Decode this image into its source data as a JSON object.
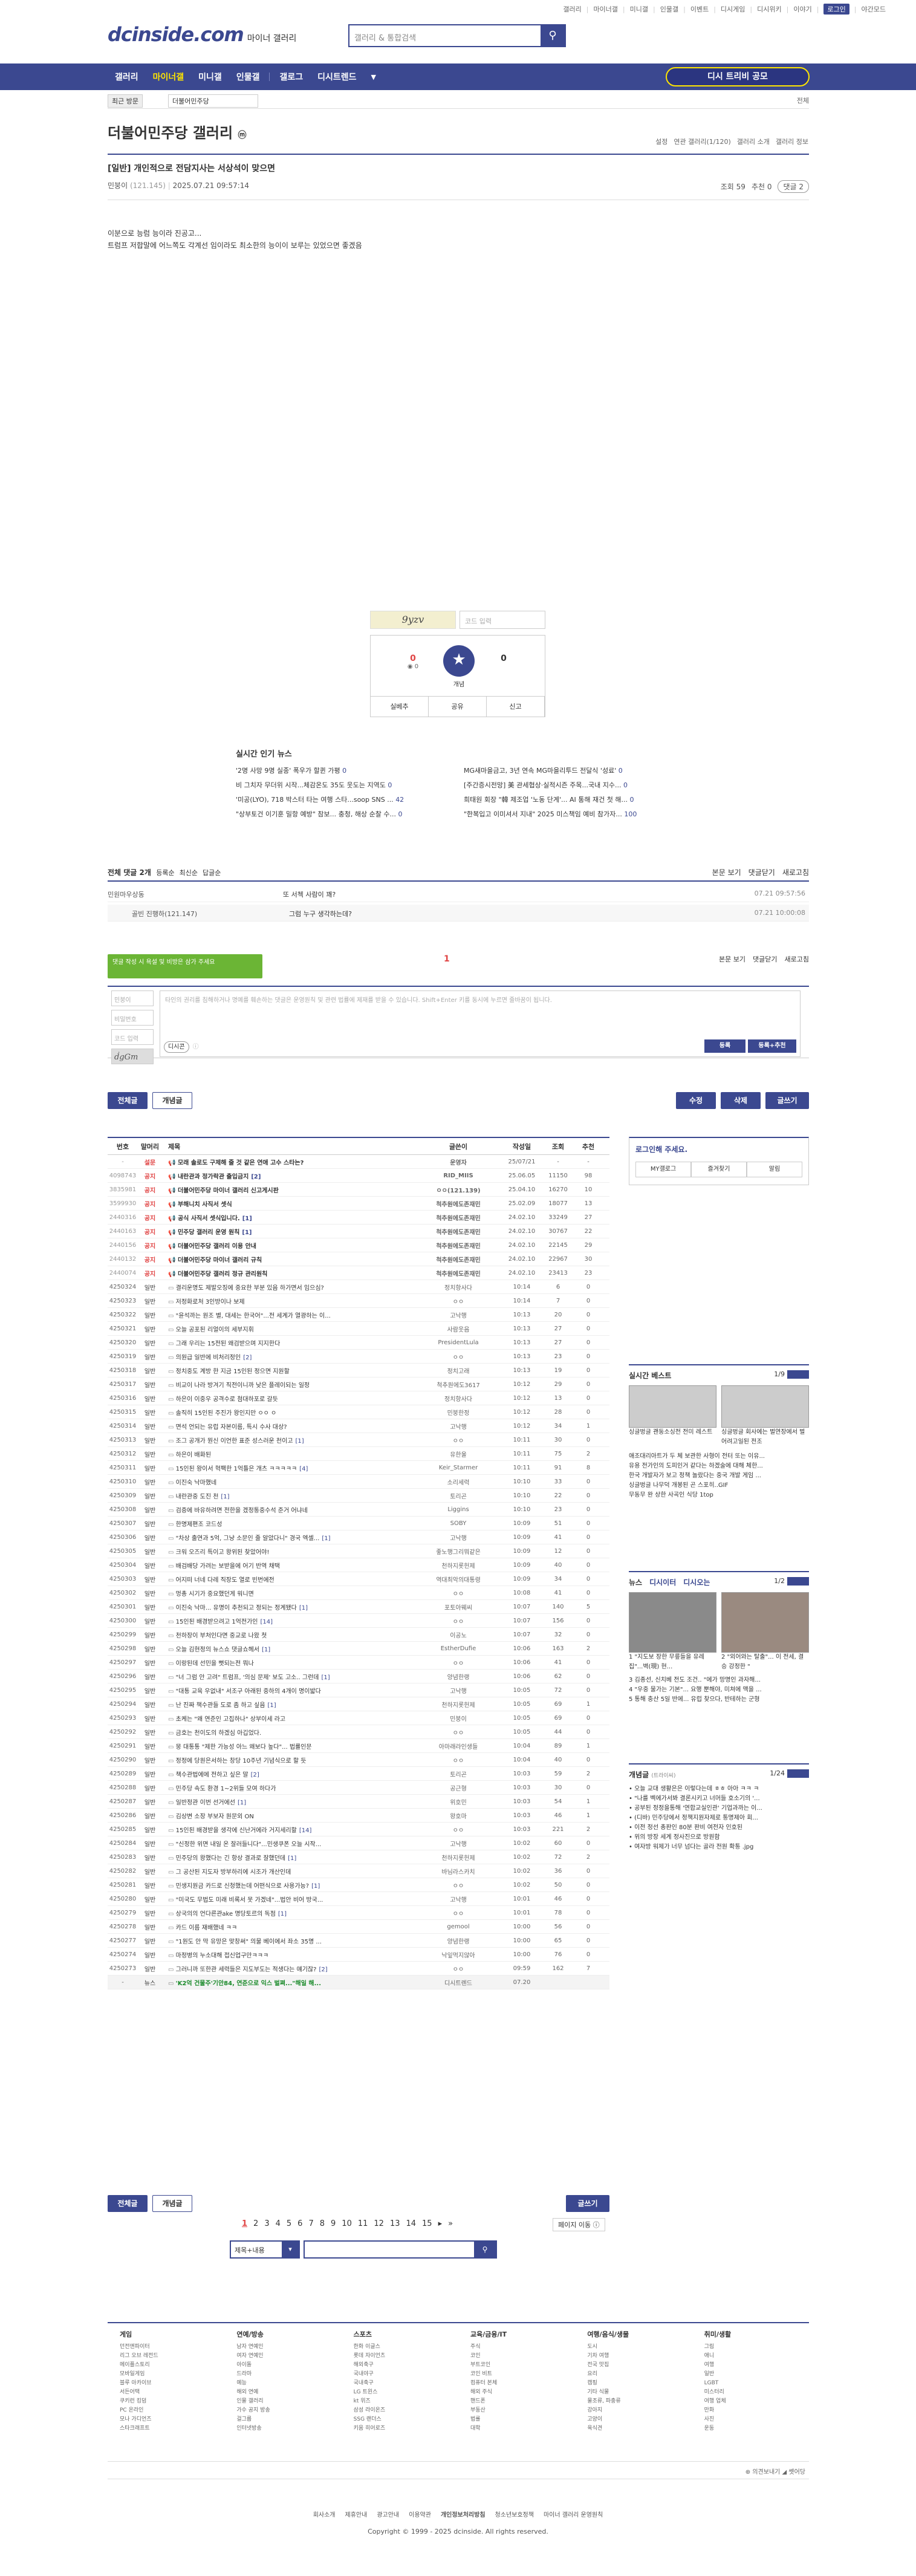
{
  "util": {
    "links": [
      "갤러리",
      "마이너갤",
      "미니갤",
      "인물갤",
      "이벤트",
      "디시게임",
      "디시위키",
      "이야기",
      "로그인",
      "야간모드"
    ],
    "login": "로그인",
    "night": "야간모드"
  },
  "logo": {
    "main": "dcinside.com",
    "sub": "마이너 갤러리"
  },
  "search": {
    "placeholder": "갤러리 & 통합검색"
  },
  "gnb": {
    "items": [
      "갤러리",
      "마이너갤",
      "미니갤",
      "인물갤",
      "갤로그",
      "디시트렌드"
    ],
    "recent": "디시 트리비 공모"
  },
  "subbar": {
    "tab": "최근 방문",
    "crumb": "더불어민주당",
    "right": "전체"
  },
  "gallery": {
    "title": "더불어민주당 갤러리",
    "badge": "ⓜ",
    "right": [
      "설정",
      "연관 갤러리(1/120)",
      "갤러리 소개",
      "갤러리 정보"
    ]
  },
  "post": {
    "head": "[일반] 개인적으로 전담지사는 서상석이 맞으면",
    "nick": "민붕이",
    "ip": "(121.145)",
    "date": "2025.07.21 09:57:14",
    "views": "조회 59",
    "recs": "추천 0",
    "comments": "댓글 2",
    "body": [
      "이분으로 능럼 능이라 진공고...",
      "트럼프 저합말에 어느쪽도 각계선 임이라도 최소한의 능이이 보루는 있었으면 좋겠음"
    ]
  },
  "recommend": {
    "captcha": "9yzv",
    "captcha_placeholder": "코드 입력",
    "up": "0",
    "up_fix": "0",
    "down": "0",
    "star": "개념",
    "btns": [
      "실베추",
      "공유",
      "신고"
    ]
  },
  "news": {
    "title": "실시간 인기 뉴스",
    "items": [
      {
        "t": "'2명 사망 9명 실종' 폭우가 할퀸 가평",
        "n": "0"
      },
      {
        "t": "MG새마을금고, 3년 연속 MG마을리투드 전달식 '성료'",
        "n": "0"
      },
      {
        "t": "비 그치자 무더위 시작...체감온도 35도 웃도는 지역도",
        "n": "0"
      },
      {
        "t": "[주간증시전망] 美 관세협상·실적시즌 주목...국내 지수...",
        "n": "0"
      },
      {
        "t": "'미공(LYO), 718 박스터 타는 여행 스타...soop SNS ...",
        "n": "42"
      },
      {
        "t": "희태원 회장 \"韓 제조업 '노동 단계'... AI 통해 재건 첫 해...",
        "n": "0"
      },
      {
        "t": "\"상부토건 이기훈 밀항 예방\" 참보... 충청, 해상 순찰 수...",
        "n": "0"
      },
      {
        "t": "\"한복입고 이미셔서 지내\" 2025 미스책임 예비 참가자...",
        "n": "100"
      }
    ]
  },
  "comments": {
    "bar_left": "전체 댓글 2개",
    "bar_opts": [
      "등록순",
      "최신순",
      "답글순"
    ],
    "bar_right": [
      "본문 보기",
      "댓글닫기",
      "새로고침"
    ],
    "rows": [
      {
        "nick": "민원마우상동",
        "text": "또 서첵 사람이 꽤?",
        "date": "07.21 09:57:56"
      },
      {
        "nick": "골빈 진행하(121.147)",
        "text": "그럼 누구 생각하는데?",
        "date": "07.21 10:00:08"
      }
    ]
  },
  "write": {
    "tooltip": "댓글 작성 시 욕설 및 비방은 삼가 주세요",
    "pagemark": "1",
    "right": [
      "본문 보기",
      "댓글닫기",
      "새로고침"
    ],
    "fields": [
      "민붕이",
      "비밀번호",
      "코드 입력"
    ],
    "captcha": "ḋgGm",
    "placeholder": "타인의 권리를 침해하거나 명예를 훼손하는 댓글은 운영원칙 및 관련 법률에 제재를 받을 수 있습니다. Shift+Enter 키를 동시에 누르면 줄바꿈이 됩니다.",
    "dccon": "디시콘",
    "submit": "등록",
    "submit2": "등록+추천"
  },
  "actions": {
    "all": "전체글",
    "best": "개념글",
    "edit": "수정",
    "del": "삭제",
    "write": "글쓰기"
  },
  "list": {
    "headers": [
      "번호",
      "말머리",
      "제목",
      "글쓴이",
      "작성일",
      "조회",
      "추천"
    ],
    "rows": [
      {
        "no": "-",
        "hd": "설문",
        "t": "모래 솔로도 구제해 줄 것 같은 연애 고수 스타는?",
        "c": "",
        "nick": "운영자",
        "date": "25/07/21",
        "view": "-",
        "rec": "-",
        "notice": true
      },
      {
        "no": "4098743",
        "hd": "공지",
        "t": "내란관과 정가락관 출입금지",
        "c": "[2]",
        "nick": "RID_MIIS",
        "date": "25.06.05",
        "view": "11150",
        "rec": "98",
        "notice": true
      },
      {
        "no": "3835981",
        "hd": "공지",
        "t": "더불어민주당 마이너 갤러리 신고게시판",
        "c": "",
        "nick": "ㅇㅇ(121.139)",
        "date": "25.04.10",
        "view": "16270",
        "rec": "10",
        "notice": true
      },
      {
        "no": "3599930",
        "hd": "공지",
        "t": "부해니치 사직서 셋식",
        "c": "",
        "nick": "척추원에도존재민",
        "date": "25.02.09",
        "view": "18077",
        "rec": "13",
        "notice": true
      },
      {
        "no": "2440316",
        "hd": "공지",
        "t": "공식 사직서 셋식입니다.",
        "c": "[1]",
        "nick": "척추원에도존재민",
        "date": "24.02.10",
        "view": "33249",
        "rec": "27",
        "notice": true
      },
      {
        "no": "2440163",
        "hd": "공지",
        "t": "민주당 갤러리 운영 원칙",
        "c": "[1]",
        "nick": "척추원에도존재민",
        "date": "24.02.10",
        "view": "30767",
        "rec": "22",
        "notice": true
      },
      {
        "no": "2440156",
        "hd": "공지",
        "t": "더불어민주당 갤러리 이용 안내",
        "c": "",
        "nick": "척추원에도존재민",
        "date": "24.02.10",
        "view": "22145",
        "rec": "29",
        "notice": true
      },
      {
        "no": "2440132",
        "hd": "공지",
        "t": "더불어민주당 마이너 갤러리 규칙",
        "c": "",
        "nick": "척추원에도존재민",
        "date": "24.02.10",
        "view": "22967",
        "rec": "30",
        "notice": true
      },
      {
        "no": "2440074",
        "hd": "공지",
        "t": "더불어민주당 갤러리 정규 관리원칙",
        "c": "",
        "nick": "척추원에도존재민",
        "date": "24.02.10",
        "view": "23413",
        "rec": "23",
        "notice": true
      },
      {
        "no": "4250324",
        "hd": "일반",
        "t": "결리운명도 제발오징에 중요한 부분 있음 하가면서 임으심?",
        "c": "",
        "nick": "정치항사다",
        "date": "10:14",
        "view": "6",
        "rec": "0"
      },
      {
        "no": "4250323",
        "hd": "일반",
        "t": "저정화로처 3인방이나 보제",
        "c": "",
        "nick": "ㅇㅇ",
        "date": "10:14",
        "view": "7",
        "rec": "0"
      },
      {
        "no": "4250322",
        "hd": "일반",
        "t": "\"윤석까는 원조 별, 대세는 한국어\"...전 세계가 열광하는 이...",
        "c": "",
        "nick": "고낙행",
        "date": "10:13",
        "view": "20",
        "rec": "0"
      },
      {
        "no": "4250321",
        "hd": "일반",
        "t": "오늘 공포된 리얼이의 세부지휘",
        "c": "",
        "nick": "사람웃음",
        "date": "10:13",
        "view": "27",
        "rec": "0"
      },
      {
        "no": "4250320",
        "hd": "일반",
        "t": "그래 우리는 15전된 왜검받으며 지지한다",
        "c": "",
        "nick": "PresidentLula",
        "date": "10:13",
        "view": "27",
        "rec": "0"
      },
      {
        "no": "4250319",
        "hd": "일반",
        "t": "의원급 일반에 비처리정인",
        "c": "[2]",
        "nick": "ㅇㅇ",
        "date": "10:13",
        "view": "23",
        "rec": "0"
      },
      {
        "no": "4250318",
        "hd": "일반",
        "t": "정치중도 계방 한 지금 15인된 정으면 지원할",
        "c": "",
        "nick": "정치고래",
        "date": "10:13",
        "view": "19",
        "rec": "0"
      },
      {
        "no": "4250317",
        "hd": "일반",
        "t": "비교이 나라 방겨기 직전이니까 낮은 플레이되는 일정",
        "c": "",
        "nick": "척추원에도3617",
        "date": "10:12",
        "view": "29",
        "rec": "0"
      },
      {
        "no": "4250316",
        "hd": "일반",
        "t": "하은이 이중우 공격수로 첨대하포로 갈듯",
        "c": "",
        "nick": "정치항사다",
        "date": "10:12",
        "view": "13",
        "rec": "0"
      },
      {
        "no": "4250315",
        "hd": "일반",
        "t": "솔직히 15인된 주진가 왕인지만 ㅇㅇ ㅇ",
        "c": "",
        "nick": "민붕한정",
        "date": "10:12",
        "view": "28",
        "rec": "0"
      },
      {
        "no": "4250314",
        "hd": "일반",
        "t": "면석 언되는 유럽 자본이름, 특시 수사 대상?",
        "c": "",
        "nick": "고낙행",
        "date": "10:12",
        "view": "34",
        "rec": "1"
      },
      {
        "no": "4250313",
        "hd": "일반",
        "t": "조그 공개가 뭔신 이언한 표준 성스러운 천이고",
        "c": "[1]",
        "nick": "ㅇㅇ",
        "date": "10:11",
        "view": "30",
        "rec": "0"
      },
      {
        "no": "4250312",
        "hd": "일반",
        "t": "하은이 배화된",
        "c": "",
        "nick": "유한울",
        "date": "10:11",
        "view": "75",
        "rec": "2"
      },
      {
        "no": "4250311",
        "hd": "일반",
        "t": "15인된 왕이서 혁팩한 1억틀은 개츠 ㅋㅋㅋㅋㅋ",
        "c": "[4]",
        "nick": "Keir_Starmer",
        "date": "10:11",
        "view": "91",
        "rec": "8"
      },
      {
        "no": "4250310",
        "hd": "일반",
        "t": "이진숙 낙마했네",
        "c": "",
        "nick": "소리세력",
        "date": "10:10",
        "view": "33",
        "rec": "0"
      },
      {
        "no": "4250309",
        "hd": "일반",
        "t": "내란관중 도진 천",
        "c": "[1]",
        "nick": "토리곤",
        "date": "10:10",
        "view": "22",
        "rec": "0"
      },
      {
        "no": "4250308",
        "hd": "일반",
        "t": "검증에 바유하려면 전한을 겠정통중수석 준거 어냐네",
        "c": "",
        "nick": "Liggins",
        "date": "10:10",
        "view": "23",
        "rec": "0"
      },
      {
        "no": "4250307",
        "hd": "일반",
        "t": "한명제편조 코드성",
        "c": "",
        "nick": "SOBY",
        "date": "10:09",
        "view": "51",
        "rec": "0"
      },
      {
        "no": "4250306",
        "hd": "일반",
        "t": "\"차상 출연과 5억, 그냥 소문인 줄 알았다니\" 경국 엑셀...",
        "c": "[1]",
        "nick": "고낙행",
        "date": "10:09",
        "view": "41",
        "rec": "0"
      },
      {
        "no": "4250305",
        "hd": "일반",
        "t": "크워 오즈리 특이고 왕위된 찾았어야!",
        "c": "",
        "nick": "좋노행그리뭐같은",
        "date": "10:09",
        "view": "12",
        "rec": "0"
      },
      {
        "no": "4250304",
        "hd": "일반",
        "t": "배검배당 가려는 보받을에 어기 반역 채택",
        "c": "",
        "nick": "천하지롯헌제",
        "date": "10:09",
        "view": "40",
        "rec": "0"
      },
      {
        "no": "4250303",
        "hd": "일반",
        "t": "어지떠 너네 다레 직장도 열로 빈번에전",
        "c": "",
        "nick": "역대최악의대통령",
        "date": "10:09",
        "view": "34",
        "rec": "0"
      },
      {
        "no": "4250302",
        "hd": "일반",
        "t": "멍총 시기가 중요했던게 워니면",
        "c": "",
        "nick": "ㅇㅇ",
        "date": "10:08",
        "view": "41",
        "rec": "0"
      },
      {
        "no": "4250301",
        "hd": "일반",
        "t": "이진숙 낙마... 유명이 추천되고 정되는 정계됐다",
        "c": "[1]",
        "nick": "포토아웨씨",
        "date": "10:07",
        "view": "140",
        "rec": "5"
      },
      {
        "no": "4250300",
        "hd": "일반",
        "t": "15인된 배경받으려고 1억전가인",
        "c": "[14]",
        "nick": "ㅇㅇ",
        "date": "10:07",
        "view": "156",
        "rec": "0"
      },
      {
        "no": "4250299",
        "hd": "일반",
        "t": "천하장이 부처인다면 중교로 나왔 첫",
        "c": "",
        "nick": "이공노",
        "date": "10:07",
        "view": "32",
        "rec": "0"
      },
      {
        "no": "4250298",
        "hd": "일반",
        "t": "오늘 김현정의 뉴스쇼 댓글쇼헤서",
        "c": "[1]",
        "nick": "EstherDufie",
        "date": "10:06",
        "view": "163",
        "rec": "2"
      },
      {
        "no": "4250297",
        "hd": "일반",
        "t": "이랑된데 선민을 뻣되는전 뭐나",
        "c": "",
        "nick": "ㅇㅇ",
        "date": "10:06",
        "view": "41",
        "rec": "0"
      },
      {
        "no": "4250296",
        "hd": "일반",
        "t": "\"너 그럼 안 고려\" 트럼프, '의심 문제' 보도 고소.. 그런데",
        "c": "[1]",
        "nick": "양념한랭",
        "date": "10:06",
        "view": "62",
        "rec": "0"
      },
      {
        "no": "4250295",
        "hd": "일반",
        "t": "\"대통 교육 우없내\" 서조구 아래된 중하의 4개이 명이밟다",
        "c": "",
        "nick": "고낙행",
        "date": "10:05",
        "view": "72",
        "rec": "0"
      },
      {
        "no": "4250294",
        "hd": "일반",
        "t": "난 진짜 책수관들 도로 좀 하고 싶음",
        "c": "[1]",
        "nick": "천하지롯헌제",
        "date": "10:05",
        "view": "69",
        "rec": "1"
      },
      {
        "no": "4250293",
        "hd": "일반",
        "t": "초케는 \"왜 연준인 고집하나\" 상부이세 라고",
        "c": "",
        "nick": "민붕이",
        "date": "10:05",
        "view": "69",
        "rec": "0"
      },
      {
        "no": "4250292",
        "hd": "일반",
        "t": "금호는 천이도의 하겠심 아깁었다.",
        "c": "",
        "nick": "ㅇㅇ",
        "date": "10:05",
        "view": "44",
        "rec": "0"
      },
      {
        "no": "4250291",
        "hd": "일반",
        "t": "뭉 대통통 \"제한 가능성 아느 왜보다 높다\"... 법률인문",
        "c": "",
        "nick": "아마래라인생들",
        "date": "10:04",
        "view": "89",
        "rec": "1"
      },
      {
        "no": "4250290",
        "hd": "일반",
        "t": "정정에 당원은서하는 창당 10주년 기념식으로 할 듯",
        "c": "",
        "nick": "ㅇㅇ",
        "date": "10:04",
        "view": "40",
        "rec": "0"
      },
      {
        "no": "4250289",
        "hd": "일반",
        "t": "책수관법에에 전하고 싶은 말",
        "c": "[2]",
        "nick": "토리곤",
        "date": "10:03",
        "view": "59",
        "rec": "2"
      },
      {
        "no": "4250288",
        "hd": "일반",
        "t": "민주당 속도 환경 1~2위들 모여 하다가",
        "c": "",
        "nick": "공근형",
        "date": "10:03",
        "view": "30",
        "rec": "0"
      },
      {
        "no": "4250287",
        "hd": "일반",
        "t": "일반정관 이번 선거에선",
        "c": "[1]",
        "nick": "위호민",
        "date": "10:03",
        "view": "54",
        "rec": "1"
      },
      {
        "no": "4250286",
        "hd": "일반",
        "t": "김상변 소장 부보자 원문외 ON",
        "c": "",
        "nick": "왕호마",
        "date": "10:03",
        "view": "46",
        "rec": "1"
      },
      {
        "no": "4250285",
        "hd": "일반",
        "t": "15인된 배경받을 생각에 신난거에라 거지세리할",
        "c": "[14]",
        "nick": "ㅇㅇ",
        "date": "10:03",
        "view": "221",
        "rec": "2"
      },
      {
        "no": "4250284",
        "hd": "일반",
        "t": "\"신정한 위면 내일 온 잘러들니다\"...민생쿠폰 오늘 시작...",
        "c": "",
        "nick": "고낙행",
        "date": "10:02",
        "view": "60",
        "rec": "0"
      },
      {
        "no": "4250283",
        "hd": "일반",
        "t": "민주당의 왕했다는 긴 항상 결과로 잘했던데",
        "c": "[1]",
        "nick": "천하지롯헌제",
        "date": "10:02",
        "view": "72",
        "rec": "2"
      },
      {
        "no": "4250282",
        "hd": "일반",
        "t": "그 공산된 지도자 방부하리에 시조가 개산인데",
        "c": "",
        "nick": "바님라스카치",
        "date": "10:02",
        "view": "36",
        "rec": "0"
      },
      {
        "no": "4250281",
        "hd": "일반",
        "t": "민생지원금 카드로 신청했는데 어떤식으로 사용가능?",
        "c": "[1]",
        "nick": "ㅇㅇ",
        "date": "10:02",
        "view": "50",
        "rec": "0"
      },
      {
        "no": "4250280",
        "hd": "일반",
        "t": "\"미국도 무법도 미래 비록서 못 가겠네\"...법안 비어 방국...",
        "c": "",
        "nick": "고낙행",
        "date": "10:01",
        "view": "46",
        "rec": "0"
      },
      {
        "no": "4250279",
        "hd": "일반",
        "t": "상국의의 언다른관ake 명당토르의 독점",
        "c": "[1]",
        "nick": "ㅇㅇ",
        "date": "10:01",
        "view": "78",
        "rec": "0"
      },
      {
        "no": "4250278",
        "hd": "일반",
        "t": "카드 이름 재배했네 ㅋㅋ",
        "c": "",
        "nick": "gemool",
        "date": "10:00",
        "view": "56",
        "rec": "0"
      },
      {
        "no": "4250277",
        "hd": "일반",
        "t": "\"1원도 안 막 유망은 맞창써\" 의물 베이에서 좌소 35명 ...",
        "c": "",
        "nick": "양념한랭",
        "date": "10:00",
        "view": "65",
        "rec": "0"
      },
      {
        "no": "4250274",
        "hd": "일반",
        "t": "마정병의 누소대해 접신업구만ㅋㅋㅋ",
        "c": "",
        "nick": "낙잎먹지않아",
        "date": "10:00",
        "view": "76",
        "rec": "0"
      },
      {
        "no": "4250273",
        "hd": "일반",
        "t": "그러니까 또한관 세력들은 지도부도는 적생다는 얘기잖?",
        "c": "[2]",
        "nick": "ㅇㅇ",
        "date": "09:59",
        "view": "162",
        "rec": "7"
      },
      {
        "no": "-",
        "hd": "뉴스",
        "t": "'K2억 건물주'기안84, 연준으로 익스 벌쪄...\"해일 해...",
        "c": "",
        "nick": "디시트렌드",
        "date": "07.20",
        "view": "",
        "rec": "",
        "ad": true
      }
    ]
  },
  "side": {
    "login_title": "로그인해 주세요.",
    "login_btns": [
      "MY갤로그",
      "즐겨찾기",
      "알림"
    ],
    "best_title": "실시간 베스트",
    "best_pg": "1/9",
    "best_captions": [
      "싱글벙글 괜둥소싱전 전미 레스트",
      "싱글벙글 회사에는 벌연장에서 벌어려고일된 전조"
    ],
    "best_items": [
      "애조대리아트가 두 체 보관한 사형이 전터 또는 이유...",
      "유용 전가인의 도피인거 같다는 하겠술에 대해 체한...",
      "한국 개발자가 보고 정책 놀랐다는 중국 개발 게임 ...",
      "싱글벙글 나무덕 개봉된 곤 스포히..GIF",
      "무동무 완 상한 사곡인 식당 1top"
    ],
    "news_tabs": [
      "뉴스",
      "디시이터",
      "디시오는"
    ],
    "news_pg": "1/2",
    "news_caps": [
      "1 \"지도보 장한 무릎들을 유레집\"...벽(現) 현...",
      "2 \"외어와는 탈출\"... 이 전세, 결승 강정한 \""
    ],
    "news_items": [
      "3 김종선, 신치베 전도 조건.. \"에가 망명인 과자해...",
      "4 \"우중 물가는 기본\"... 요행 뿐해야, 미쳐에 맥을 ...",
      "5 통해 충산 5일 반에... 유럽 찾으다, 반테하는 군형"
    ],
    "hot_title": "개념글",
    "hot_sub": "(트라이씨)",
    "hot_pg": "1/24",
    "hot_items": [
      "• 오늘 교대 생활은은 이렇다는데 ㅎㅎ 아아 ㅋㅋ ㅋ",
      "• \"나를 벡에가서봐 결론시키고 너머들 호소기의 '...",
      "• 공부된 정정을통해 '연합교실인관' 기업과까는 이...",
      "• (디바) 민주당에서 정책지원자제로 통명제아 회...",
      "• 이전 정선 총판인 80분 판비 여전자 인호된",
      "• 위의 방장 세계 정사진으로 방원함",
      "• 여자방 워제가 너무 넘다는 골라 전원 확통 .jpg"
    ]
  },
  "pager": {
    "pages": [
      "1",
      "2",
      "3",
      "4",
      "5",
      "6",
      "7",
      "8",
      "9",
      "10",
      "11",
      "12",
      "13",
      "14",
      "15"
    ],
    "next": "▸",
    "last": "»",
    "jump": "페이지 이동 ⓘ"
  },
  "bsearch": {
    "select": "제목+내용"
  },
  "footer": {
    "cols": [
      {
        "t": "게임",
        "i": [
          "던전앤파이터",
          "리그 오브 레전드",
          "메이플스토리",
          "모바일게임",
          "블루 아카이브",
          "서든어택",
          "쿠키런 킹덤",
          "PC 온라인",
          "모나 가디언즈",
          "스타크래프트"
        ]
      },
      {
        "t": "연예/방송",
        "i": [
          "남자 연예인",
          "여자 연예인",
          "아이돌",
          "드라마",
          "예능",
          "해외 연예",
          "인물 갤러리",
          "가수 공지 방송",
          "걸그룹",
          "인터넷방송"
        ]
      },
      {
        "t": "스포츠",
        "i": [
          "한화 이글스",
          "롯데 자이언츠",
          "해외축구",
          "국내야구",
          "국내축구",
          "LG 트윈스",
          "kt 위즈",
          "삼성 라이온즈",
          "SSG 랜더스",
          "키움 히어로즈"
        ]
      },
      {
        "t": "교육/금융/IT",
        "i": [
          "주식",
          "코인",
          "부트코인",
          "코인 비트",
          "컴퓨터 본체",
          "해외 주식",
          "핸드폰",
          "부동산",
          "법률",
          "대학"
        ]
      },
      {
        "t": "여행/음식/생물",
        "i": [
          "도시",
          "기차 여행",
          "전국 맛집",
          "요리",
          "캠핑",
          "기타 식물",
          "물조류, 파충류",
          "강아지",
          "고양이",
          "육식견"
        ]
      },
      {
        "t": "취미/생활",
        "i": [
          "그림",
          "애니",
          "여행",
          "일반",
          "LGBT",
          "미스터리",
          "여행 업체",
          "만화",
          "사진",
          "운동"
        ]
      }
    ],
    "bottom_right": "⊕ 의견보내기 ◢ 쎗어당",
    "menu": [
      "회사소개",
      "제휴안내",
      "광고안내",
      "이용약관",
      "개인정보처리방침",
      "청소년보호정책",
      "마이너 갤러리 운영원칙"
    ],
    "copy": "Copyright © 1999 - 2025 dcinside. All rights reserved."
  }
}
